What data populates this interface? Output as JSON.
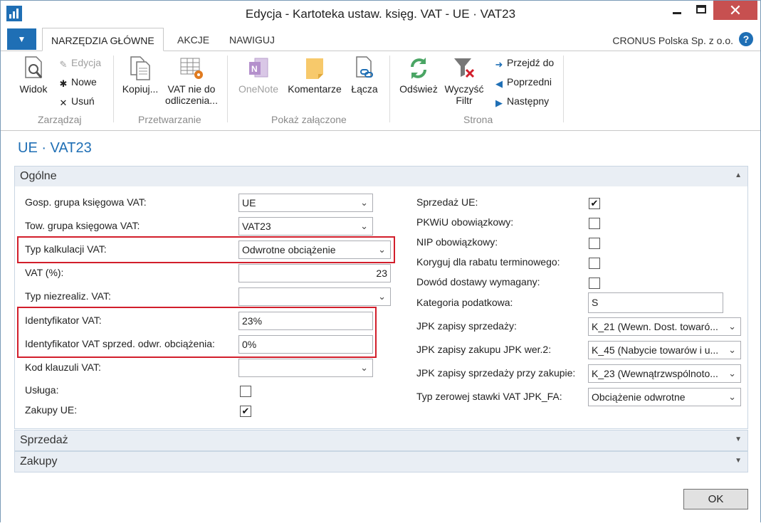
{
  "window": {
    "title": "Edycja - Kartoteka ustaw. księg. VAT - UE · VAT23",
    "close_glyph": "✕"
  },
  "ribbon_tabs": [
    {
      "label": "NARZĘDZIA GŁÓWNE"
    },
    {
      "label": "AKCJE"
    },
    {
      "label": "NAWIGUJ"
    }
  ],
  "company": "CRONUS Polska Sp. z o.o.",
  "help_glyph": "?",
  "menu_glyph": "▼",
  "ribbon": {
    "view": "Widok",
    "edit": "Edycja",
    "new": "Nowe",
    "delete": "Usuń",
    "group_manage": "Zarządzaj",
    "copy": "Kopiuj...",
    "vat_nondeduct_1": "VAT nie do",
    "vat_nondeduct_2": "odliczenia...",
    "group_process": "Przetwarzanie",
    "onenote": "OneNote",
    "comments": "Komentarze",
    "links": "Łącza",
    "group_attachments": "Pokaż załączone",
    "refresh": "Odśwież",
    "clear_filter_1": "Wyczyść",
    "clear_filter_2": "Filtr",
    "goto": "Przejdź do",
    "previous": "Poprzedni",
    "next": "Następny",
    "group_page": "Strona"
  },
  "page_title": "UE · VAT23",
  "sections": {
    "general": "Ogólne",
    "sales": "Sprzedaż",
    "purchases": "Zakupy"
  },
  "left_fields": {
    "gen_bus_group": {
      "label": "Gosp. grupa księgowa VAT:",
      "value": "UE"
    },
    "prod_group": {
      "label": "Tow. grupa księgowa VAT:",
      "value": "VAT23"
    },
    "calc_type": {
      "label": "Typ kalkulacji VAT:",
      "value": "Odwrotne obciążenie"
    },
    "vat_pct": {
      "label": "VAT (%):",
      "value": "23"
    },
    "unreal_type": {
      "label": "Typ niezrealiz. VAT:",
      "value": ""
    },
    "vat_id": {
      "label": "Identyfikator VAT:",
      "value": "23%"
    },
    "vat_id_reverse": {
      "label": "Identyfikator VAT sprzed. odwr. obciążenia:",
      "value": "0%"
    },
    "clause_code": {
      "label": "Kod klauzuli VAT:",
      "value": ""
    },
    "service": {
      "label": "Usługa:",
      "checked": false
    },
    "eu_purchases": {
      "label": "Zakupy UE:",
      "checked": true
    }
  },
  "right_fields": {
    "eu_sales": {
      "label": "Sprzedaż UE:",
      "checked": true
    },
    "pkwiu_req": {
      "label": "PKWiU obowiązkowy:",
      "checked": false
    },
    "nip_req": {
      "label": "NIP obowiązkowy:",
      "checked": false
    },
    "adjust_discount": {
      "label": "Koryguj dla rabatu terminowego:",
      "checked": false
    },
    "delivery_proof": {
      "label": "Dowód dostawy wymagany:",
      "checked": false
    },
    "tax_category": {
      "label": "Kategoria podatkowa:",
      "value": "S"
    },
    "jpk_sales": {
      "label": "JPK zapisy sprzedaży:",
      "value": "K_21 (Wewn. Dost. towaró..."
    },
    "jpk_purch": {
      "label": "JPK zapisy zakupu JPK wer.2:",
      "value": "K_45 (Nabycie towarów i u..."
    },
    "jpk_sales_purch": {
      "label": "JPK zapisy sprzedaży przy zakupie:",
      "value": "K_23 (Wewnątrzwspólnoto..."
    },
    "zero_rate": {
      "label": "Typ zerowej stawki VAT  JPK_FA:",
      "value": "Obciążenie odwrotne"
    }
  },
  "checkmark": "✔",
  "dropdown_glyph": "⌄",
  "chevron_up": "▲",
  "chevron_down": "▼",
  "ok_label": "OK",
  "highlight_color": "#d21e2b",
  "accent_color": "#1f6fb5"
}
